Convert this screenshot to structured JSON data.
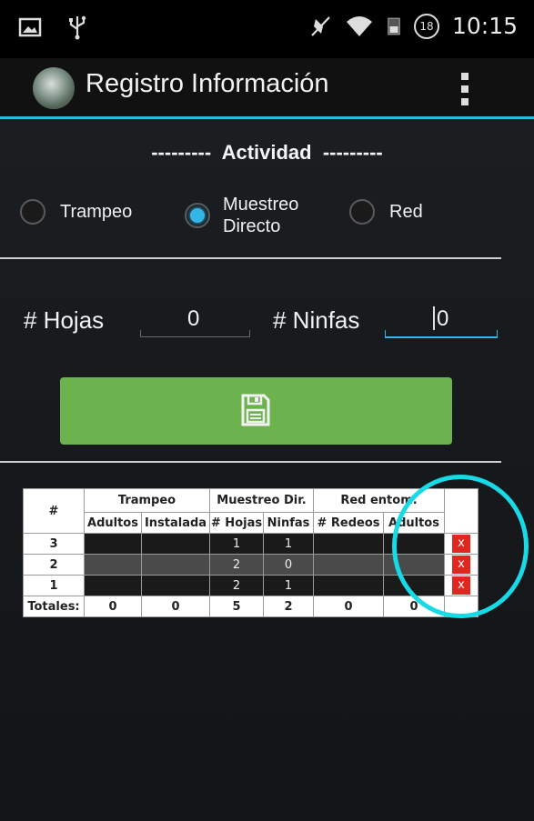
{
  "status_bar": {
    "left_icons": [
      "image-icon",
      "usb-icon"
    ],
    "right_icons": [
      "mute-icon",
      "wifi-icon",
      "signal-icon",
      "notification-count-icon"
    ],
    "notification_count": "18",
    "time": "10:15"
  },
  "action_bar": {
    "title": "Registro Información",
    "menu_icon": "overflow-menu-icon"
  },
  "activity_heading": "---------  Actividad  ---------",
  "activity_options": [
    {
      "label": "Trampeo",
      "checked": false
    },
    {
      "label": "Muestreo Directo",
      "checked": true
    },
    {
      "label": "Red",
      "checked": false
    }
  ],
  "fields": {
    "hojas": {
      "label": "# Hojas",
      "value": "0"
    },
    "ninfas": {
      "label": "# Ninfas",
      "value": "0"
    }
  },
  "save_button": {
    "icon": "save-icon"
  },
  "table": {
    "header_hash": "#",
    "groups": [
      "Trampeo",
      "Muestreo Dir.",
      "Red entom."
    ],
    "subheaders": [
      "Adultos",
      "Instalada",
      "# Hojas",
      "Ninfas",
      "# Redeos",
      "Adultos"
    ],
    "rows": [
      {
        "id": "3",
        "cells": [
          "",
          "",
          "1",
          "1",
          "",
          ""
        ],
        "delete": "x"
      },
      {
        "id": "2",
        "cells": [
          "",
          "",
          "2",
          "0",
          "",
          ""
        ],
        "delete": "x"
      },
      {
        "id": "1",
        "cells": [
          "",
          "",
          "2",
          "1",
          "",
          ""
        ],
        "delete": "x"
      }
    ],
    "totals_label": "Totales:",
    "totals": [
      "0",
      "0",
      "5",
      "2",
      "0",
      "0"
    ]
  },
  "colors": {
    "accent": "#33b5e5",
    "save_green": "#6cb24e",
    "delete_red": "#e0261e",
    "annotation": "#18d9e6"
  }
}
